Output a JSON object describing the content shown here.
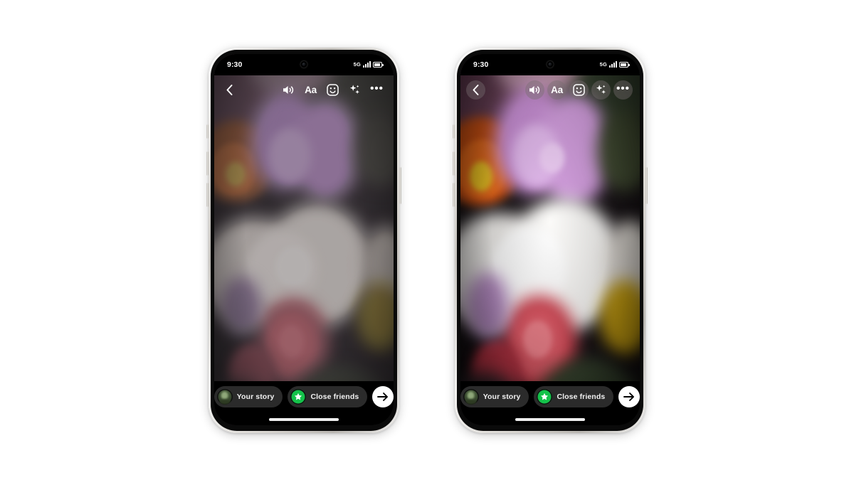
{
  "scene": {
    "description": "Instagram Stories editor shown on two phones side by side, before and after photo enhancement",
    "background_color": "#ffffff",
    "phone_count": 2
  },
  "phones": [
    {
      "id": "phone-left",
      "variant": "original",
      "toolbar_chips_visible": false,
      "status_bar": {
        "time": "9:30",
        "network": "5G",
        "signal_bars": 4,
        "battery_level": 85
      },
      "toolbar": {
        "back_label": "Back",
        "items": [
          {
            "name": "sound-icon",
            "label": "Sound"
          },
          {
            "name": "text-icon",
            "label": "Aa"
          },
          {
            "name": "sticker-icon",
            "label": "Stickers"
          },
          {
            "name": "effects-icon",
            "label": "Effects"
          },
          {
            "name": "more-icon",
            "label": "More"
          }
        ]
      },
      "bottom_bar": {
        "your_story_label": "Your story",
        "close_friends_label": "Close friends",
        "next_label": "Next"
      }
    },
    {
      "id": "phone-right",
      "variant": "enhanced",
      "toolbar_chips_visible": true,
      "status_bar": {
        "time": "9:30",
        "network": "5G",
        "signal_bars": 4,
        "battery_level": 85
      },
      "toolbar": {
        "back_label": "Back",
        "items": [
          {
            "name": "sound-icon",
            "label": "Sound"
          },
          {
            "name": "text-icon",
            "label": "Aa"
          },
          {
            "name": "sticker-icon",
            "label": "Stickers"
          },
          {
            "name": "effects-icon",
            "label": "Effects"
          },
          {
            "name": "more-icon",
            "label": "More"
          }
        ]
      },
      "bottom_bar": {
        "your_story_label": "Your story",
        "close_friends_label": "Close friends",
        "next_label": "Next"
      }
    }
  ],
  "colors": {
    "close_friends_green": "#14c24a",
    "pill_background": "#2b2b2b",
    "next_button": "#ffffff",
    "screen_black": "#000000",
    "frame_titanium": "#d8d5d0"
  },
  "photo": {
    "subject": "Flower bouquet",
    "flowers": [
      "pink chrysanthemum",
      "orange zinnia",
      "white hydrangea",
      "pink carnation",
      "yellow bloom",
      "purple statice"
    ]
  }
}
